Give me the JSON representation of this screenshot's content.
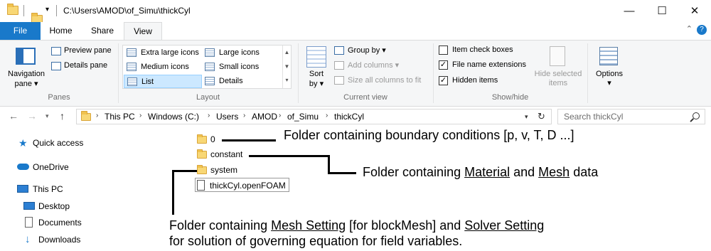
{
  "titlebar": {
    "path": "C:\\Users\\AMOD\\of_Simu\\thickCyl",
    "minimize": "—",
    "maximize": "☐",
    "close": "✕"
  },
  "tabs": [
    "File",
    "Home",
    "Share",
    "View"
  ],
  "ribbon": {
    "panes": {
      "nav_pane_line1": "Navigation",
      "nav_pane_line2": "pane ▾",
      "preview_pane": "Preview pane",
      "details_pane": "Details pane",
      "label": "Panes"
    },
    "layout": {
      "items": [
        "Extra large icons",
        "Large icons",
        "Medium icons",
        "Small icons",
        "List",
        "Details"
      ],
      "label": "Layout"
    },
    "current_view": {
      "sort_line1": "Sort",
      "sort_line2": "by ▾",
      "group_by": "Group by ▾",
      "add_columns": "Add columns ▾",
      "size_columns": "Size all columns to fit",
      "label": "Current view"
    },
    "show_hide": {
      "item_check_boxes": "Item check boxes",
      "file_name_extensions": "File name extensions",
      "hidden_items": "Hidden items",
      "hide_selected_line1": "Hide selected",
      "hide_selected_line2": "items",
      "label": "Show/hide",
      "checks": {
        "item_check_boxes": false,
        "file_name_extensions": true,
        "hidden_items": true
      }
    },
    "options": {
      "line1": "Options",
      "line2": "▾"
    }
  },
  "address": {
    "crumbs": [
      "This PC",
      "Windows (C:)",
      "Users",
      "AMOD",
      "of_Simu",
      "thickCyl"
    ],
    "search_placeholder": "Search thickCyl"
  },
  "nav": {
    "items": [
      "Quick access",
      "OneDrive",
      "This PC",
      "Desktop",
      "Documents",
      "Downloads"
    ]
  },
  "files": [
    {
      "name": "0",
      "type": "folder"
    },
    {
      "name": "constant",
      "type": "folder"
    },
    {
      "name": "system",
      "type": "folder"
    },
    {
      "name": "thickCyl.openFOAM",
      "type": "file"
    }
  ],
  "annotations": {
    "zero": "Folder containing boundary conditions [p, v, T, D ...]",
    "constant_pre": "Folder containing ",
    "constant_material": "Material",
    "constant_mid": " and ",
    "constant_mesh": "Mesh",
    "constant_post": " data",
    "system_pre": "Folder containing ",
    "system_mesh_setting": "Mesh Setting",
    "system_mid": " [for blockMesh] and ",
    "system_solver_setting": "Solver Setting",
    "system_line2": "for solution of governing equation for field variables."
  }
}
